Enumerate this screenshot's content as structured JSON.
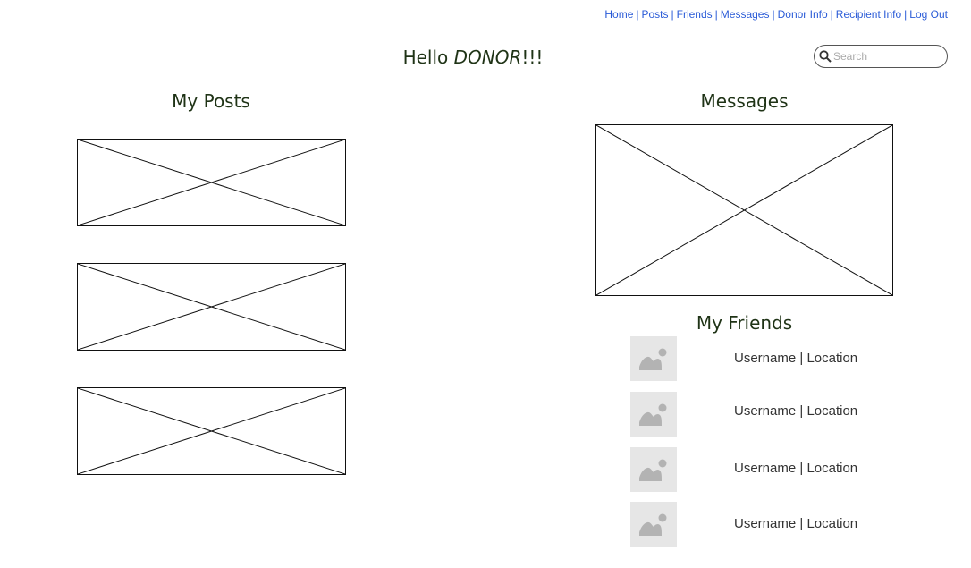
{
  "nav": {
    "items": [
      "Home",
      "Posts",
      "Friends",
      "Messages",
      "Donor Info",
      "Recipient Info",
      "Log Out"
    ],
    "separator": "|"
  },
  "search": {
    "placeholder": "Search",
    "value": ""
  },
  "greeting": {
    "prefix": "Hello ",
    "name": "DONOR",
    "suffix": "!!!"
  },
  "posts": {
    "title": "My Posts",
    "count_shown": 3
  },
  "messages": {
    "title": "Messages"
  },
  "friends": {
    "title": "My Friends",
    "items": [
      {
        "username": "Username",
        "separator": " | ",
        "location": "Location"
      },
      {
        "username": "Username",
        "separator": " | ",
        "location": "Location"
      },
      {
        "username": "Username",
        "separator": " | ",
        "location": "Location"
      },
      {
        "username": "Username",
        "separator": " | ",
        "location": "Location"
      }
    ]
  },
  "colors": {
    "link": "#2a5bd7",
    "heading": "#1f3316",
    "avatar_bg": "#e6e6e6",
    "avatar_icon": "#b3b3b3"
  },
  "icons": {
    "search": "search-icon",
    "avatar": "image-placeholder-icon"
  }
}
